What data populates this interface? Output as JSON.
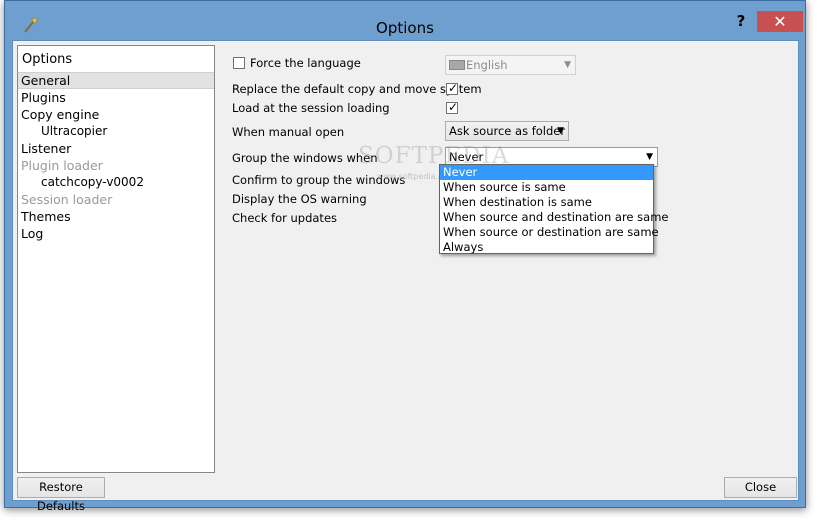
{
  "window": {
    "title": "Options",
    "help": "?",
    "close": "✕"
  },
  "sidebar": {
    "header": "Options",
    "items": [
      {
        "label": "General",
        "level": 0,
        "selected": true
      },
      {
        "label": "Plugins",
        "level": 0
      },
      {
        "label": "Copy engine",
        "level": 0
      },
      {
        "label": "Ultracopier",
        "level": 1
      },
      {
        "label": "Listener",
        "level": 0
      },
      {
        "label": "Plugin loader",
        "level": 0,
        "disabled": true
      },
      {
        "label": "catchcopy-v0002",
        "level": 1
      },
      {
        "label": "Session loader",
        "level": 0,
        "disabled": true
      },
      {
        "label": "Themes",
        "level": 0
      },
      {
        "label": "Log",
        "level": 0
      }
    ]
  },
  "general": {
    "force_language": {
      "label": "Force the language",
      "checked": false,
      "value": "English"
    },
    "replace_copy": {
      "label": "Replace the default copy and move system",
      "checked": true
    },
    "load_session": {
      "label": "Load at the session loading",
      "checked": true
    },
    "manual_open": {
      "label": "When manual open",
      "value": "Ask source as folder"
    },
    "group_windows": {
      "label": "Group the windows when",
      "value": "Never",
      "options": [
        "Never",
        "When source is same",
        "When destination is same",
        "When source and destination are same",
        "When source or destination are same",
        "Always"
      ]
    },
    "confirm_group": {
      "label": "Confirm to group the windows"
    },
    "os_warning": {
      "label": "Display the OS warning"
    },
    "check_updates": {
      "label": "Check for updates"
    }
  },
  "watermark": {
    "text": "SOFTPEDIA",
    "sub": "www.softpedia.com"
  },
  "buttons": {
    "restore": "Restore Defaults",
    "close": "Close"
  },
  "colors": {
    "frame": "#6f9fce",
    "close_button": "#c75050",
    "highlight": "#3399ff"
  }
}
